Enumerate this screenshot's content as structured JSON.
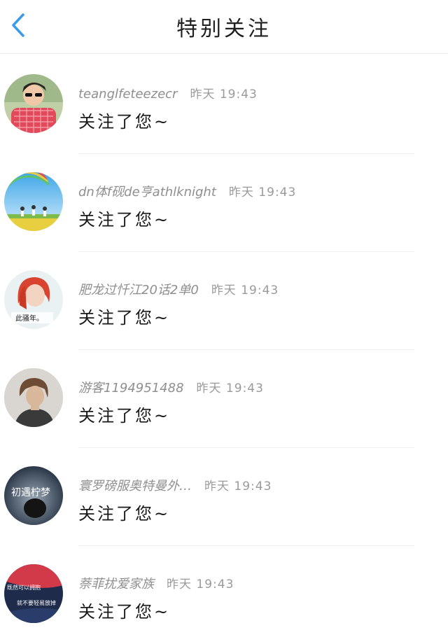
{
  "header": {
    "title": "特别关注",
    "back_icon": "chevron-left-icon",
    "accent_color": "#3a9be6"
  },
  "notifications": [
    {
      "user": "teanglfeteezecr",
      "time": "昨天 19:43",
      "message": "关注了您~",
      "avatar": "boy-red-shirt"
    },
    {
      "user": "dn体f砚de亨athlknight",
      "time": "昨天 19:43",
      "message": "关注了您~",
      "avatar": "rainbow-field"
    },
    {
      "user": "肥龙过忏江20话2单0",
      "time": "昨天 19:43",
      "message": "关注了您~",
      "avatar": "red-hair-girl",
      "avatar_text": "此骚年。"
    },
    {
      "user": "游客1194951488",
      "time": "昨天 19:43",
      "message": "关注了您~",
      "avatar": "short-hair-portrait"
    },
    {
      "user": "寰罗磅服奥特曼外…",
      "time": "昨天 19:43",
      "message": "关注了您~",
      "avatar": "dark-blue-text",
      "avatar_text": "初遇柠梦"
    },
    {
      "user": "萘菲扰爱家族",
      "time": "昨天 19:43",
      "message": "关注了您~",
      "avatar": "red-text-graphic",
      "avatar_text_1": "既然可以拥抱",
      "avatar_text_2": "就不要轻易放掉"
    }
  ]
}
